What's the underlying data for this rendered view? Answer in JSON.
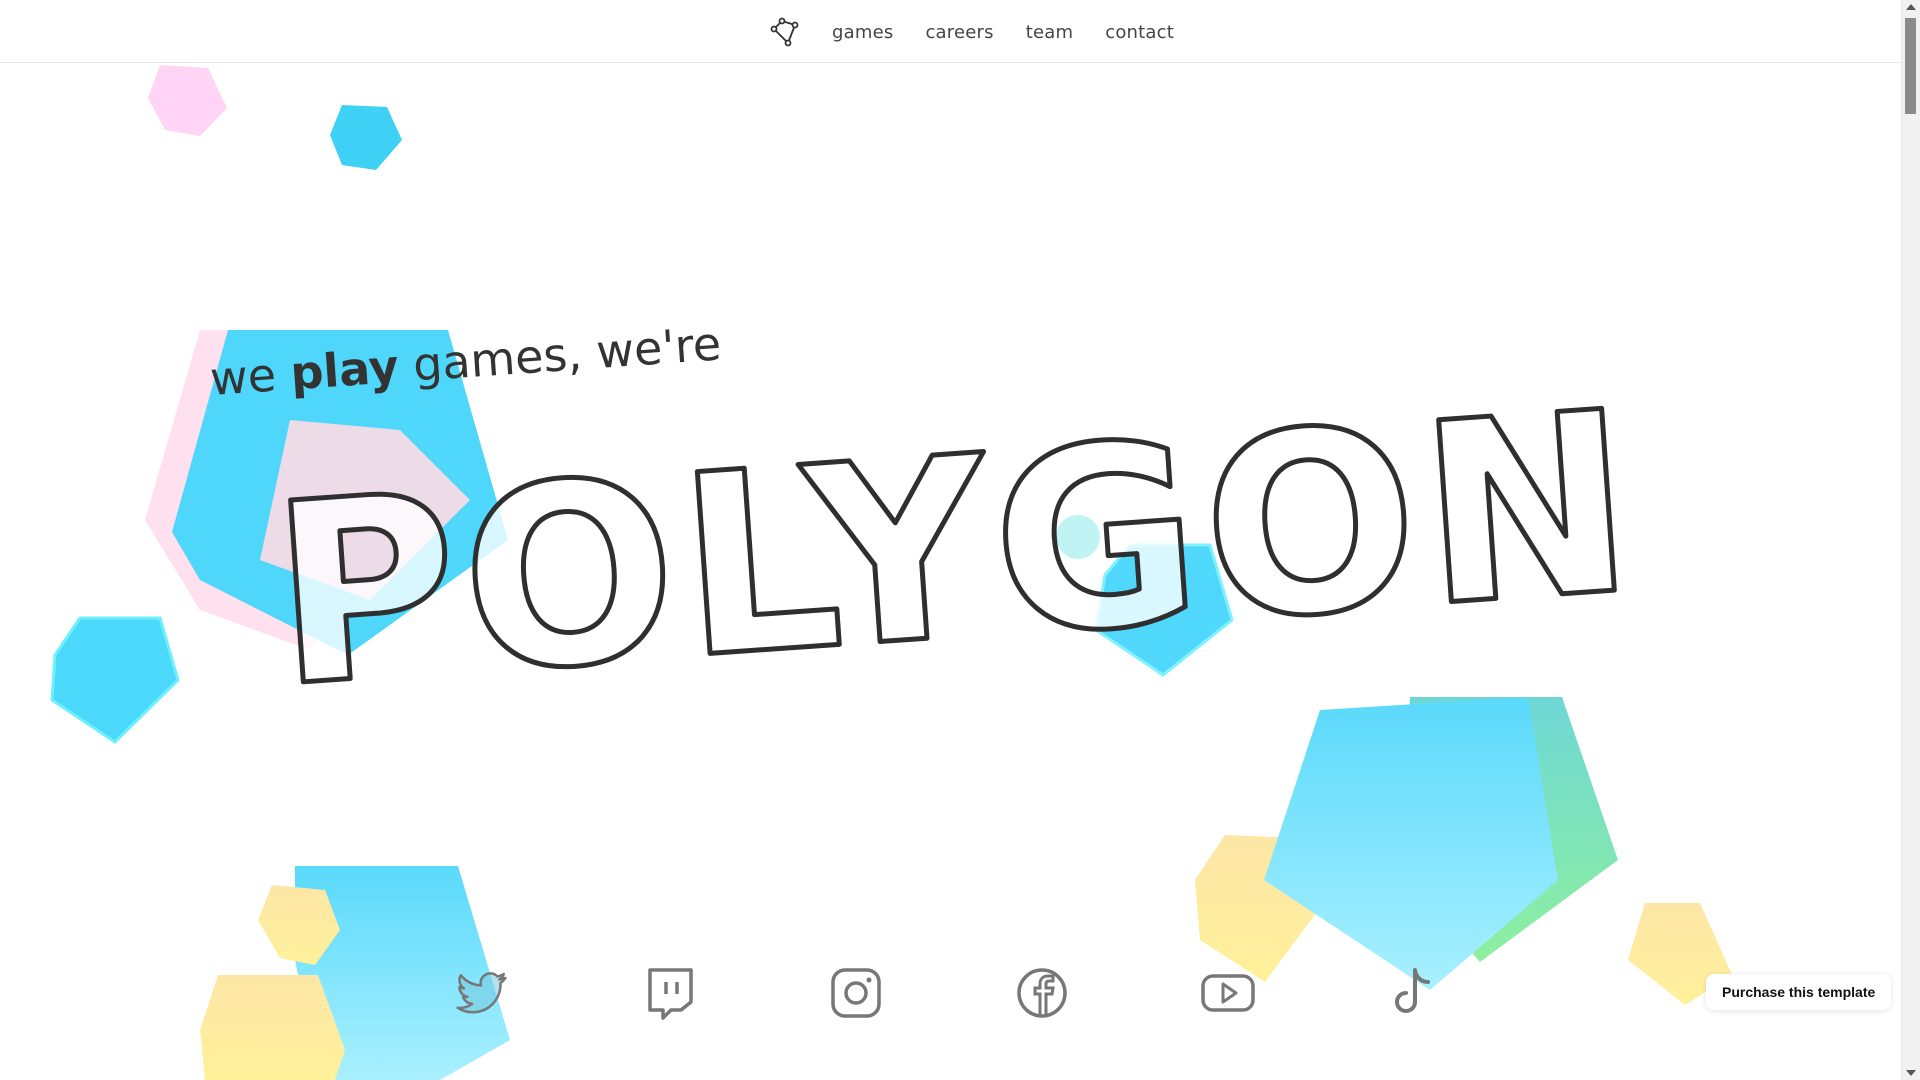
{
  "nav": {
    "logo_icon": "polygon-nodes-icon",
    "links": [
      "games",
      "careers",
      "team",
      "contact"
    ]
  },
  "hero": {
    "tagline_prefix": "we ",
    "tagline_bold": "play",
    "tagline_suffix": " games, we're",
    "title": "POLYGON"
  },
  "social": {
    "icons": [
      "twitter-icon",
      "twitch-icon",
      "instagram-icon",
      "facebook-icon",
      "youtube-icon",
      "tiktok-icon"
    ]
  },
  "purchase": {
    "label": "Purchase this template"
  },
  "colors": {
    "cyan": "#4fd8fb",
    "pink": "#ffd0ec",
    "yellow": "#fde9a0",
    "green": "#7fe8a8",
    "outline": "#2f2f2f"
  }
}
